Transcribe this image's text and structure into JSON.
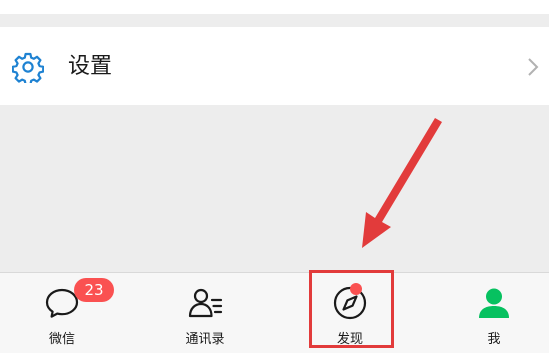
{
  "settings": {
    "label": "设置"
  },
  "tabbar": {
    "tabs": [
      {
        "label": "微信",
        "badge": "23"
      },
      {
        "label": "通讯录"
      },
      {
        "label": "发现"
      },
      {
        "label": "我"
      }
    ]
  },
  "colors": {
    "accent": "#07c160",
    "badge": "#fa5151",
    "annotation": "#e23b3b",
    "icon_blue": "#1e82d2"
  }
}
